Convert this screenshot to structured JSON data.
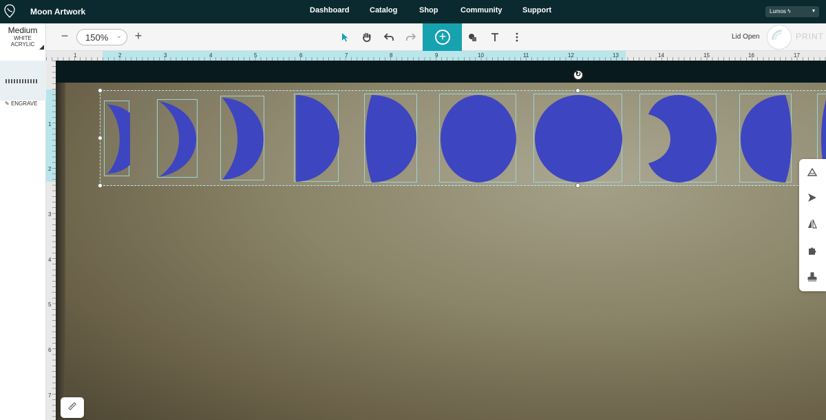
{
  "app": {
    "doc_title": "Moon Artwork",
    "nav": [
      "Dashboard",
      "Catalog",
      "Shop",
      "Community",
      "Support"
    ],
    "machine": "Lumos ϟ"
  },
  "material": {
    "thickness": "Medium",
    "name_line1": "WHITE",
    "name_line2": "ACRYLIC"
  },
  "toolbar": {
    "zoom": "150%",
    "zoom_minus": "−",
    "zoom_plus": "+",
    "lid_status": "Lid Open",
    "print_label": "PRINT"
  },
  "left_panel": {
    "operation": "ENGRAVE"
  },
  "rulers": {
    "horizontal": [
      "1",
      "2",
      "3",
      "4",
      "5",
      "6",
      "7",
      "8",
      "9",
      "10",
      "11",
      "12",
      "13",
      "14",
      "15",
      "16",
      "17"
    ],
    "vertical": [
      "1",
      "2",
      "3",
      "4",
      "5",
      "6",
      "7"
    ]
  },
  "colors": {
    "nav_bg": "#0b2a2f",
    "accent": "#17a2b0",
    "artwork": "#3e45c0"
  },
  "artwork": {
    "phases": [
      "waxing-crescent-thin",
      "waxing-crescent",
      "waxing-crescent-large",
      "first-quarter",
      "waxing-gibbous-1",
      "waxing-gibbous-2",
      "full-moon",
      "waning-gibbous-1",
      "waning-gibbous-2",
      "partial"
    ]
  }
}
